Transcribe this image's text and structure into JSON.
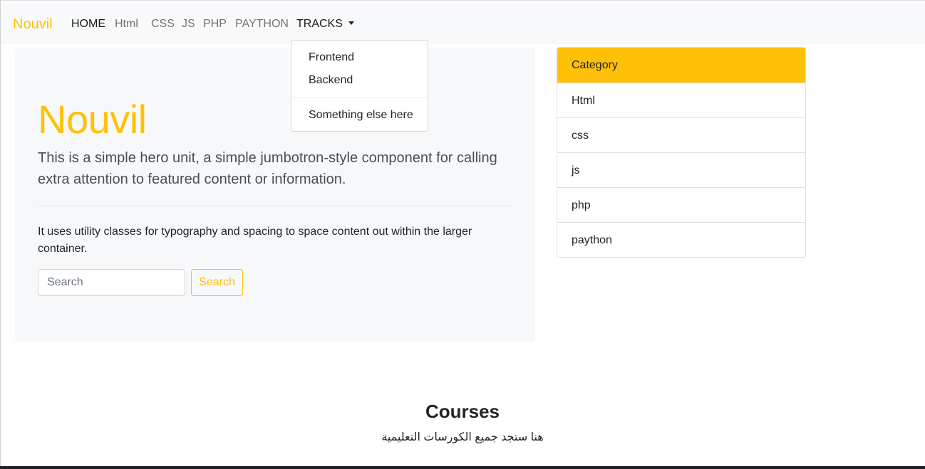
{
  "navbar": {
    "brand": "Nouvil",
    "items": [
      {
        "label": "HOME"
      },
      {
        "label": "Html"
      },
      {
        "label": "CSS"
      },
      {
        "label": "JS"
      },
      {
        "label": "PHP"
      },
      {
        "label": "PAYTHON"
      },
      {
        "label": "TRACKS"
      }
    ]
  },
  "dropdown": {
    "items": [
      "Frontend",
      "Backend",
      "Something else here"
    ]
  },
  "hero": {
    "title": "Nouvil",
    "lead": "This is a simple hero unit, a simple jumbotron-style component for calling extra attention to featured content or information.",
    "paragraph": "It uses utility classes for typography and spacing to space content out within the larger container.",
    "search_placeholder": "Search",
    "search_button": "Search"
  },
  "category": {
    "header": "Category",
    "items": [
      "Html",
      "css",
      "js",
      "php",
      "paython"
    ]
  },
  "courses": {
    "title": "Courses",
    "subtitle": "هنا ستجد جميع الكورسات التعليمية"
  },
  "colors": {
    "accent": "#ffc107",
    "navbar_bg": "#f8f9fa"
  }
}
